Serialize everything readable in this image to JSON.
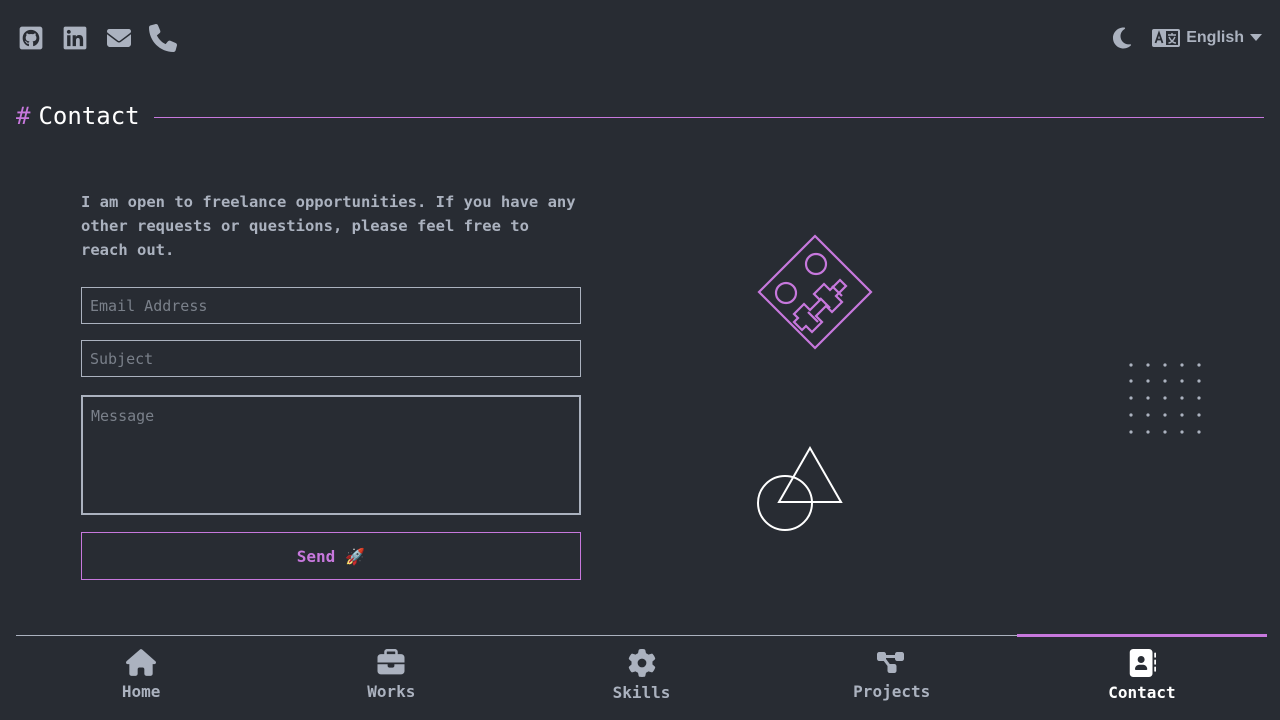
{
  "header": {
    "social_icons": [
      "github-icon",
      "linkedin-icon",
      "email-icon",
      "phone-icon"
    ],
    "theme_icon": "moon-icon",
    "language": {
      "icon": "translate-icon",
      "selected": "English"
    }
  },
  "section": {
    "hash": "#",
    "title": "Contact"
  },
  "contact": {
    "intro": "I am open to freelance opportunities. If you have any other requests or questions, please feel free to reach out.",
    "email_placeholder": "Email Address",
    "subject_placeholder": "Subject",
    "message_placeholder": "Message",
    "send_label": "Send",
    "send_emoji": "🚀"
  },
  "nav": {
    "items": [
      {
        "label": "Home",
        "icon": "home-icon"
      },
      {
        "label": "Works",
        "icon": "briefcase-icon"
      },
      {
        "label": "Skills",
        "icon": "gear-icon"
      },
      {
        "label": "Projects",
        "icon": "project-diagram-icon"
      },
      {
        "label": "Contact",
        "icon": "contact-book-icon"
      }
    ],
    "active": "Contact"
  },
  "colors": {
    "background": "#282c33",
    "accent": "#c778dd",
    "text": "#abb2bf",
    "white": "#ffffff"
  }
}
